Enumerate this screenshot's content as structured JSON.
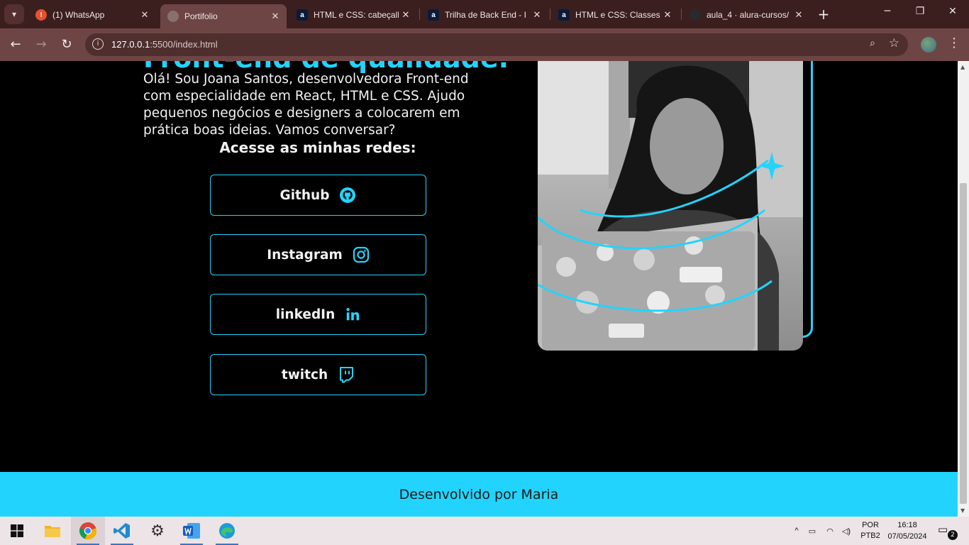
{
  "browser": {
    "tabs": [
      {
        "title": "(1) WhatsApp",
        "icon": "whatsapp-icon"
      },
      {
        "title": "Portifolio",
        "icon": "globe-icon"
      },
      {
        "title": "HTML e CSS: cabeçalho",
        "icon": "alura-icon"
      },
      {
        "title": "Trilha de Back End - I",
        "icon": "alura-icon"
      },
      {
        "title": "HTML e CSS: Classes,",
        "icon": "alura-icon"
      },
      {
        "title": "aula_4 · alura-cursos/",
        "icon": "github-icon"
      }
    ],
    "url_host": "127.0.0.1",
    "url_path": ":5500/index.html"
  },
  "page": {
    "hero_title": "Front-end de qualidade.",
    "intro": "Olá! Sou Joana Santos, desenvolvedora Front-end com especialidade em React, HTML e CSS. Ajudo pequenos negócios e designers a colocarem em prática boas ideias. Vamos conversar?",
    "social_heading": "Acesse as minhas redes:",
    "social_links": [
      {
        "label": "Github",
        "icon": "github-icon"
      },
      {
        "label": "Instagram",
        "icon": "instagram-icon"
      },
      {
        "label": "linkedIn",
        "icon": "linkedin-icon"
      },
      {
        "label": "twitch",
        "icon": "twitch-icon"
      }
    ],
    "footer": "Desenvolvido por Maria",
    "accent_color": "#22d4fd"
  },
  "taskbar": {
    "language": "POR",
    "keyboard": "PTB2",
    "time": "16:18",
    "date": "07/05/2024",
    "notifications": "2"
  }
}
